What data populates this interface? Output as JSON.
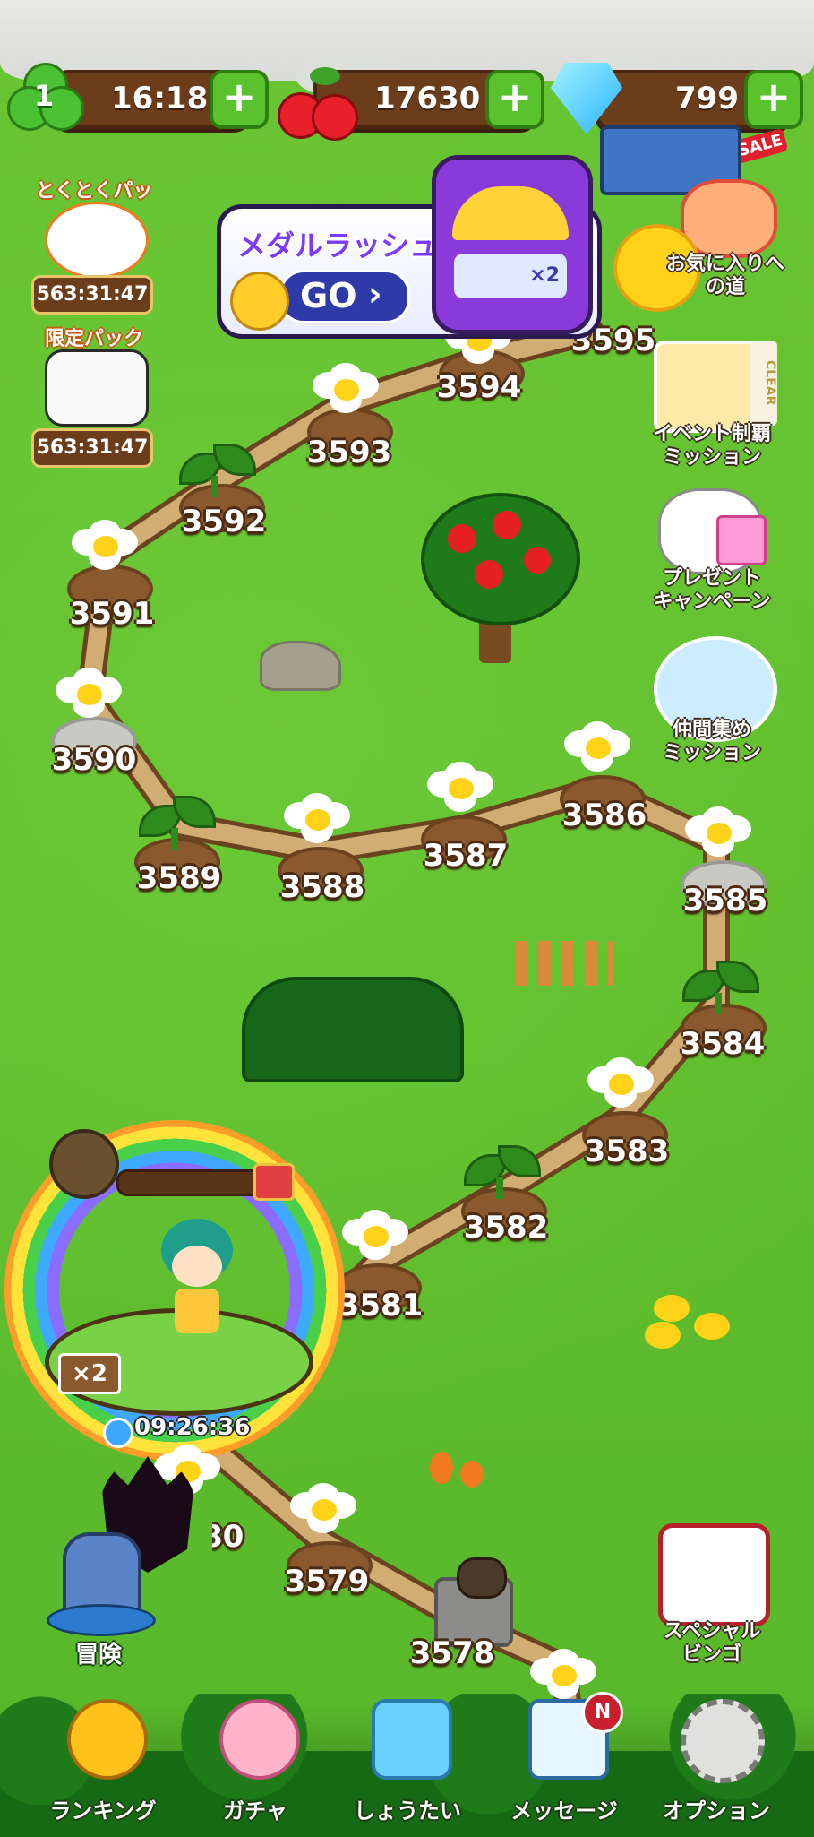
{
  "top_bar": {
    "level": "1",
    "clover_timer": "16:18",
    "cherries": "17630",
    "gems": "799",
    "sale_badge": "SALE",
    "plus_label": "+"
  },
  "banner": {
    "title": "メダルラッシュ",
    "go_label": "GO",
    "multiplier": "×2"
  },
  "left_packs": [
    {
      "title": "とくとくパック",
      "timer": "563:31:47"
    },
    {
      "title": "限定パック",
      "timer": "563:31:47"
    }
  ],
  "right_buttons": [
    {
      "label": "お気に入りへの道"
    },
    {
      "label": "イベント制覇\nミッション",
      "badge": "CLEAR"
    },
    {
      "label": "プレゼント\nキャンペーン"
    },
    {
      "label": "仲間集め\nミッション"
    },
    {
      "label": "スペシャル\nビンゴ"
    }
  ],
  "stages": [
    "3595",
    "3594",
    "3593",
    "3592",
    "3591",
    "3590",
    "3589",
    "3588",
    "3587",
    "3586",
    "3585",
    "3584",
    "3583",
    "3582",
    "3581",
    "3580",
    "3579",
    "3578"
  ],
  "player": {
    "multiplier": "×2",
    "timer": "09:26:36"
  },
  "adventure": {
    "label": "冒険"
  },
  "nav": [
    {
      "label": "ランキング",
      "icon": "trophy-icon"
    },
    {
      "label": "ガチャ",
      "icon": "bunny-icon"
    },
    {
      "label": "しょうたい",
      "icon": "invite-icon"
    },
    {
      "label": "メッセージ",
      "icon": "mail-icon",
      "badge": "N"
    },
    {
      "label": "オプション",
      "icon": "gear-icon"
    }
  ],
  "colors": {
    "grass": "#5cbf2a",
    "wood": "#6b3d1b",
    "plus_green": "#59c22c",
    "path": "#c9a46a"
  }
}
